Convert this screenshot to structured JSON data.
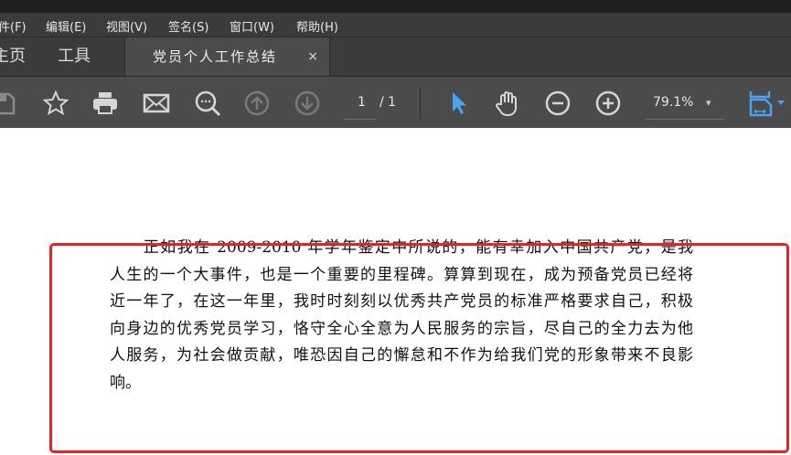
{
  "menu": [
    "件(F)",
    "编辑(E)",
    "视图(V)",
    "签名(S)",
    "窗口(W)",
    "帮助(H)"
  ],
  "tabs": {
    "home": "主页",
    "tools": "工具",
    "document": "党员个人工作总结",
    "close": "×"
  },
  "toolbar": {
    "page_current": "1",
    "page_total": "/ 1",
    "zoom": "79.1%",
    "zoom_caret": "▾"
  },
  "document": {
    "lines": [
      "　　正如我在 2009-2010 年学年鉴定中所说的，能有幸加入中国共产党，是我",
      "人生的一个大事件，也是一个重要的里程碑。算算到现在，成为预备党员已经将",
      "近一年了，在这一年里，我时时刻刻以优秀共产党员的标准严格要求自己，积极",
      "向身边的优秀党员学习，恪守全心全意为人民服务的宗旨，尽自己的全力去为他",
      "人服务，为社会做贡献，唯恐因自己的懈怠和不作为给我们党的形象带来不良影",
      "响。"
    ]
  },
  "colors": {
    "accent": "#4aa3f0",
    "highlight": "#e8221f"
  }
}
